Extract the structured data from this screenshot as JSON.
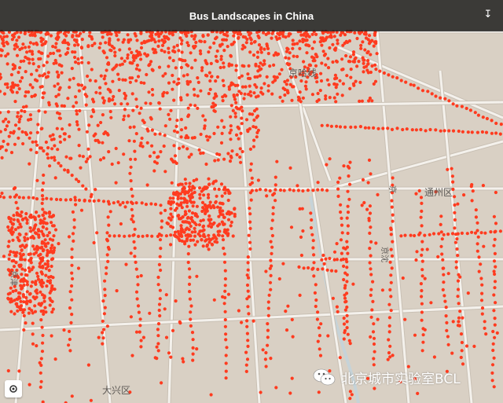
{
  "header": {
    "title": "Bus Landscapes in China",
    "collapse_icon": "double-chevron-down-icon"
  },
  "map": {
    "colors": {
      "land": "#d9d0c4",
      "road": "#f4f1ec",
      "road_casing": "#c9c0b4",
      "bus_stop": "#ff3b1f",
      "title_bar": "#181818",
      "water": "#c6d3d8"
    },
    "labels": {
      "beijing_line": "京哈线",
      "tongzhou": "通州区",
      "daxing": "大兴区",
      "road_a": "京",
      "road_b": "京沈",
      "road_c": "京津"
    },
    "markers": "bus-stop-dots"
  },
  "watermark": {
    "text": "北京城市实验室BCL",
    "icon": "wechat-icon"
  },
  "controls": {
    "locate_icon": "locate-icon"
  }
}
